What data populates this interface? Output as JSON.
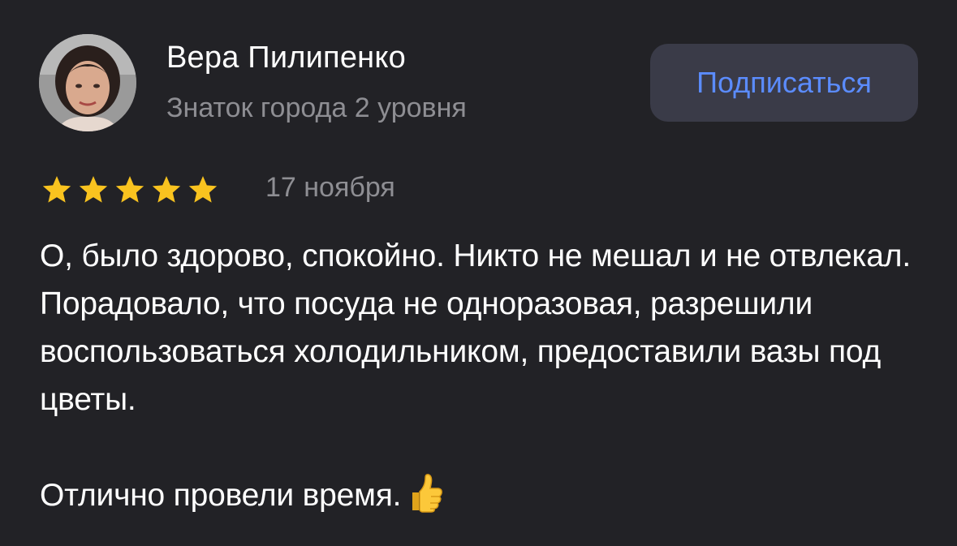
{
  "author": {
    "name": "Вера Пилипенко",
    "level": "Знаток города 2 уровня"
  },
  "actions": {
    "subscribe_label": "Подписаться"
  },
  "review": {
    "rating": 5,
    "rating_max": 5,
    "date": "17 ноября",
    "paragraphs": [
      "О, было здорово, спокойно. Никто не мешал и не отвлекал. Порадовало, что посуда не одноразовая, разрешили воспользоваться холодильником, предоставили вазы под цветы.",
      "Отлично провели время."
    ],
    "emoji": "thumbs-up-icon"
  },
  "colors": {
    "background": "#222226",
    "button_bg": "#3a3b48",
    "accent": "#5b8cff",
    "secondary_text": "#8e8e93",
    "star": "#f9c31f"
  }
}
